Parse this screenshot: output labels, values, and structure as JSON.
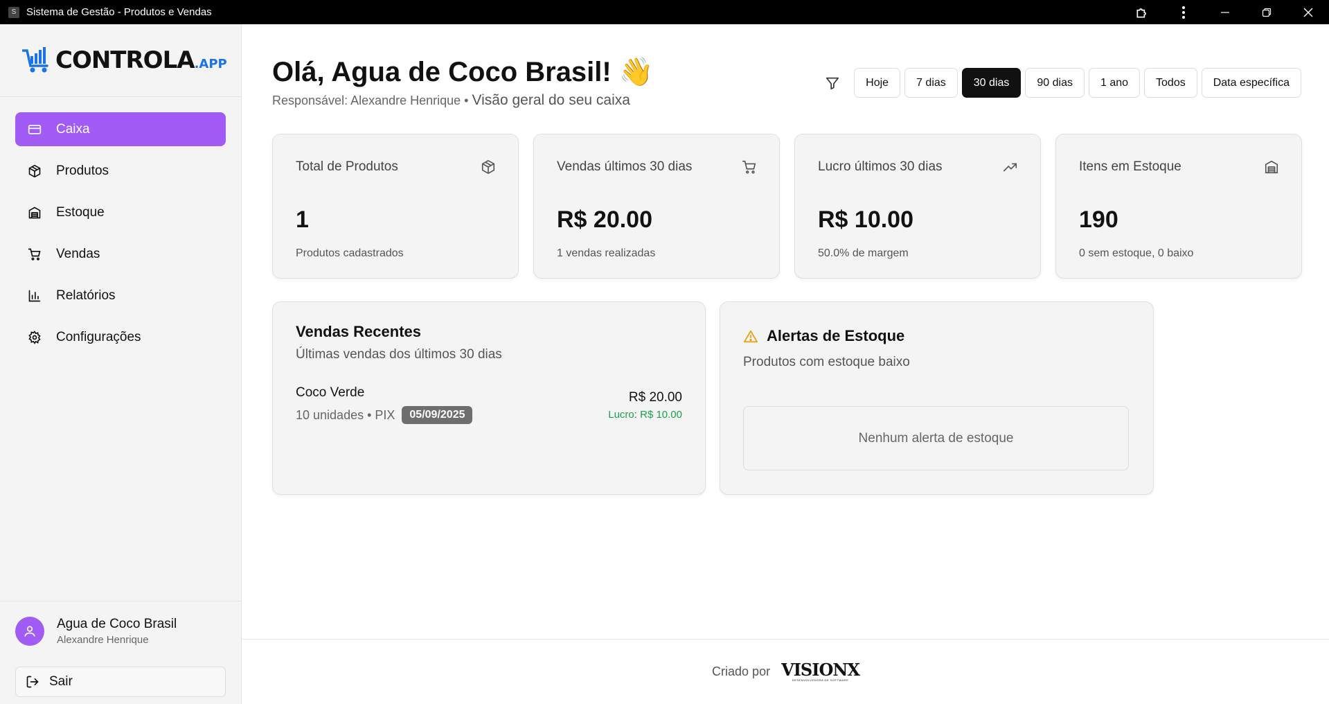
{
  "window": {
    "title": "Sistema de Gestão - Produtos e Vendas",
    "app_icon_letter": "S"
  },
  "logo": {
    "word": "CONTROLA",
    "tld": ".APP",
    "accent_color": "#1a73e8"
  },
  "sidebar": {
    "items": [
      {
        "label": "Caixa",
        "icon": "credit-card-icon",
        "active": true
      },
      {
        "label": "Produtos",
        "icon": "box-icon",
        "active": false
      },
      {
        "label": "Estoque",
        "icon": "warehouse-icon",
        "active": false
      },
      {
        "label": "Vendas",
        "icon": "cart-icon",
        "active": false
      },
      {
        "label": "Relatórios",
        "icon": "bar-chart-icon",
        "active": false
      },
      {
        "label": "Configurações",
        "icon": "gear-icon",
        "active": false
      }
    ],
    "active_color": "#a15cf5",
    "user": {
      "name": "Agua de Coco Brasil",
      "role": "Alexandre Henrique"
    },
    "logout_label": "Sair"
  },
  "header": {
    "greeting": "Olá, Agua de Coco Brasil! 👋",
    "subtitle_prefix": "Responsável: Alexandre Henrique • ",
    "subtitle_main": "Visão geral do seu caixa"
  },
  "filters": {
    "options": [
      "Hoje",
      "7 dias",
      "30 dias",
      "90 dias",
      "1 ano",
      "Todos",
      "Data específica"
    ],
    "selected": "30 dias"
  },
  "cards": [
    {
      "title": "Total de Produtos",
      "icon": "box-icon",
      "value": "1",
      "sub": "Produtos cadastrados"
    },
    {
      "title": "Vendas últimos 30 dias",
      "icon": "cart-icon",
      "value": "R$ 20.00",
      "sub": "1 vendas realizadas"
    },
    {
      "title": "Lucro últimos 30 dias",
      "icon": "trending-up-icon",
      "value": "R$ 10.00",
      "sub": "50.0% de margem"
    },
    {
      "title": "Itens em Estoque",
      "icon": "warehouse-icon",
      "value": "190",
      "sub": "0 sem estoque, 0 baixo"
    }
  ],
  "recent_sales": {
    "title": "Vendas Recentes",
    "description": "Últimas vendas dos últimos 30 dias",
    "items": [
      {
        "product": "Coco Verde",
        "meta": "10 unidades • PIX",
        "date": "05/09/2025",
        "value": "R$ 20.00",
        "profit": "Lucro: R$ 10.00"
      }
    ],
    "profit_color": "#17a34a"
  },
  "stock_alerts": {
    "title": "Alertas de Estoque",
    "description": "Produtos com estoque baixo",
    "empty_text": "Nenhum alerta de estoque",
    "warning_color": "#e8a317"
  },
  "footer": {
    "created_by": "Criado por",
    "brand": "VISIONX",
    "brand_tagline": "DESENVOLVEDORA DE SOFTWARE"
  }
}
